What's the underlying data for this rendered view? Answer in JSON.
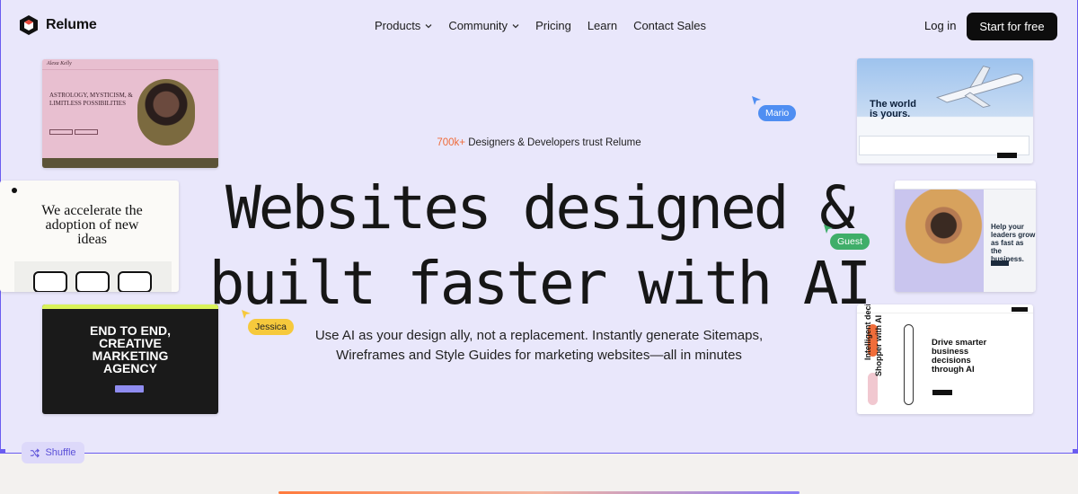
{
  "brand": {
    "name": "Relume"
  },
  "nav": {
    "menu": [
      {
        "label": "Products",
        "dropdown": true
      },
      {
        "label": "Community",
        "dropdown": true
      },
      {
        "label": "Pricing",
        "dropdown": false
      },
      {
        "label": "Learn",
        "dropdown": false
      },
      {
        "label": "Contact Sales",
        "dropdown": false
      }
    ],
    "login": "Log in",
    "cta": "Start for free"
  },
  "hero": {
    "trust_count": "700k+",
    "trust_text": " Designers & Developers trust Relume",
    "headline_line1": "Websites designed &",
    "headline_line2": "built faster with AI",
    "sub_line1": "Use AI as your design ally, not a replacement. Instantly generate Sitemaps,",
    "sub_line2": "Wireframes and Style Guides for marketing websites—all in minutes"
  },
  "cursors": [
    {
      "name": "Mario",
      "color": "#4f8ef2"
    },
    {
      "name": "Guest",
      "color": "#3fae69"
    },
    {
      "name": "Jessica",
      "color": "#f6c93c"
    }
  ],
  "cards": {
    "astrology": {
      "brand": "Alexa Kelly",
      "title": "ASTROLOGY, MYSTICISM, & LIMITLESS POSSIBILITIES"
    },
    "accelerate": {
      "title": "We accelerate the adoption of new ideas"
    },
    "agency": {
      "title_line1": "END TO END,",
      "title_line2": "CREATIVE",
      "title_line3": "MARKETING",
      "title_line4": "AGENCY"
    },
    "world": {
      "title": "The world is yours."
    },
    "leaders": {
      "title": "Help your leaders grow as fast as the business."
    },
    "drive": {
      "title": "Drive smarter business decisions through AI",
      "vertical_1": "Intelligent decision",
      "vertical_2": "Shopper with AI"
    }
  },
  "shuffle": {
    "label": "Shuffle"
  },
  "colors": {
    "accent": "#6a5cf0",
    "trust": "#ef6b3a",
    "background": "#e9e7fb"
  }
}
